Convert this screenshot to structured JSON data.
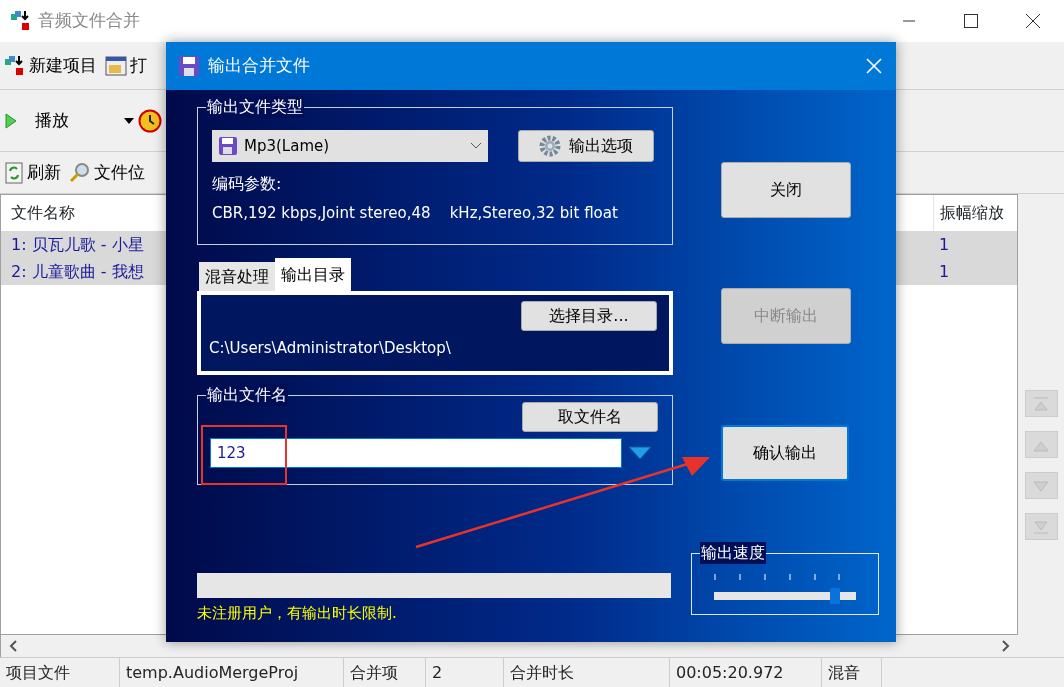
{
  "window": {
    "title": "音频文件合并"
  },
  "toolbar_rows": [
    [
      {
        "label": "新建项目"
      },
      {
        "label": "打"
      }
    ],
    [
      {
        "label": "播放"
      },
      {}
    ],
    [
      {
        "label": "刷新"
      },
      {
        "label": "文件位"
      }
    ]
  ],
  "table": {
    "columns": [
      "文件名称",
      "振幅缩放"
    ],
    "rows": [
      {
        "cells": [
          "1: 贝瓦儿歌 - 小星",
          "1"
        ],
        "selected": true
      },
      {
        "cells": [
          "2: 儿童歌曲 - 我想",
          "1"
        ],
        "selected": true
      }
    ]
  },
  "side_buttons": [
    {
      "disabled": true
    },
    {
      "disabled": true
    },
    {
      "disabled": true
    },
    {
      "disabled": true
    }
  ],
  "status_bar": [
    "项目文件",
    "temp.AudioMergeProj",
    "合并项",
    "2",
    "合并时长",
    "00:05:20.972",
    "混音"
  ],
  "dialog": {
    "title": "输出合并文件",
    "file_type": {
      "legend": "输出文件类型",
      "format": "Mp3(Lame)",
      "options_button": "输出选项",
      "params_label": "编码参数:",
      "params": "CBR,192 kbps,Joint stereo,48    kHz,Stereo,32 bit float"
    },
    "tabs": [
      {
        "label": "混音处理",
        "selected": false
      },
      {
        "label": "输出目录",
        "selected": true
      }
    ],
    "output_dir": {
      "button": "选择目录...",
      "path": "C:\\Users\\Administrator\\Desktop\\"
    },
    "file_name": {
      "legend": "输出文件名",
      "button": "取文件名",
      "value": "123"
    },
    "buttons": [
      {
        "label": "关闭",
        "disabled": false,
        "default": false
      },
      {
        "label": "中断输出",
        "disabled": true,
        "default": false
      },
      {
        "label": "确认输出",
        "disabled": false,
        "default": true
      }
    ],
    "progress": {
      "level": 0
    },
    "notice": "未注册用户，有输出时长限制.",
    "speed": {
      "legend": "输出速度",
      "level": 0.85
    }
  }
}
